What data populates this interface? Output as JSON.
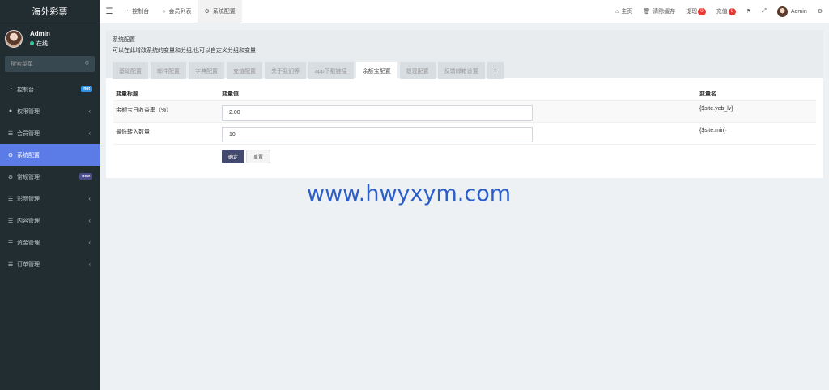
{
  "sidebar": {
    "brand": "海外彩票",
    "user": {
      "name": "Admin",
      "status": "在线"
    },
    "search_placeholder": "搜索菜单",
    "items": [
      {
        "label": "控制台",
        "icon": "dashboard-icon",
        "badge": "hot",
        "badge_color": "#2e8fe6"
      },
      {
        "label": "权限管理",
        "icon": "users-icon",
        "chev": "‹"
      },
      {
        "label": "会员管理",
        "icon": "list-icon",
        "chev": "‹"
      },
      {
        "label": "系统配置",
        "icon": "gear-icon"
      },
      {
        "label": "常规管理",
        "icon": "cogs-icon",
        "badge": "new",
        "badge_color": "#4a4c8c"
      },
      {
        "label": "彩票管理",
        "icon": "list-icon",
        "chev": "‹"
      },
      {
        "label": "内容管理",
        "icon": "list-icon",
        "chev": "‹"
      },
      {
        "label": "资金管理",
        "icon": "list-icon",
        "chev": "‹"
      },
      {
        "label": "订单管理",
        "icon": "list-icon",
        "chev": "‹"
      }
    ]
  },
  "topbar": {
    "tabs": [
      {
        "label": "控制台",
        "icon": "dashboard-icon"
      },
      {
        "label": "会员列表",
        "icon": "circle-icon"
      },
      {
        "label": "系统配置",
        "icon": "gear-icon"
      }
    ],
    "right": {
      "home": "主页",
      "clear_cache": "清除缓存",
      "withdraw": "提现",
      "withdraw_count": "0",
      "recharge": "充值",
      "recharge_count": "0",
      "admin": "Admin"
    }
  },
  "panel": {
    "title": "系统配置",
    "desc": "可以在此增改系统的变量和分组,也可以自定义分组和变量",
    "tabs": [
      "基础配置",
      "邮件配置",
      "字典配置",
      "充值配置",
      "关于我们等",
      "app下载链接",
      "余额宝配置",
      "提现配置",
      "反馈邮箱设置"
    ],
    "active_tab": "余额宝配置",
    "plus": "+",
    "table": {
      "headers": [
        "变量标题",
        "变量值",
        "变量名"
      ],
      "rows": [
        {
          "title": "余额宝日收益率（%）",
          "value": "2.00",
          "name": "{$site.yeb_lv}"
        },
        {
          "title": "最低转入数量",
          "value": "10",
          "name": "{$site.min}"
        }
      ]
    },
    "buttons": {
      "ok": "确定",
      "reset": "重置"
    }
  },
  "watermark": "www.hwyxym.com"
}
